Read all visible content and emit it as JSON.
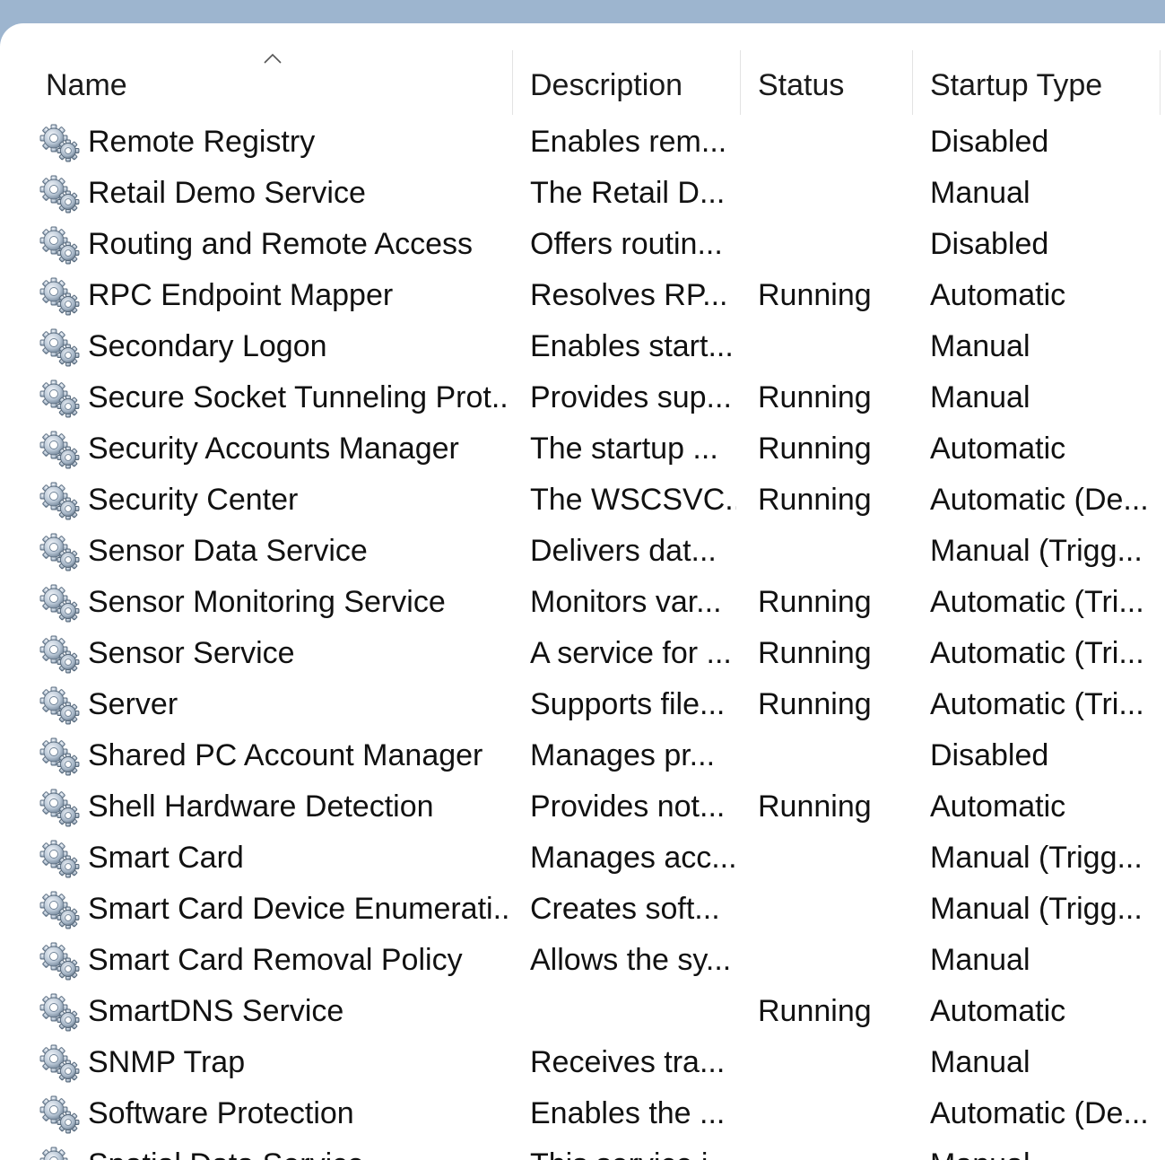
{
  "columns": {
    "name": "Name",
    "description": "Description",
    "status": "Status",
    "startup_type": "Startup Type"
  },
  "sort": {
    "column": "Name",
    "direction": "ascending"
  },
  "colors": {
    "title_bar": "#9db5cf",
    "background": "#ffffff",
    "text": "#111111"
  },
  "rows": [
    {
      "name": "Remote Registry",
      "description": "Enables rem...",
      "status": "",
      "startup": "Disabled"
    },
    {
      "name": "Retail Demo Service",
      "description": "The Retail D...",
      "status": "",
      "startup": "Manual"
    },
    {
      "name": "Routing and Remote Access",
      "description": "Offers routin...",
      "status": "",
      "startup": "Disabled"
    },
    {
      "name": "RPC Endpoint Mapper",
      "description": "Resolves RP...",
      "status": "Running",
      "startup": "Automatic"
    },
    {
      "name": "Secondary Logon",
      "description": "Enables start...",
      "status": "",
      "startup": "Manual"
    },
    {
      "name": "Secure Socket Tunneling Prot...",
      "description": "Provides sup...",
      "status": "Running",
      "startup": "Manual"
    },
    {
      "name": "Security Accounts Manager",
      "description": "The startup ...",
      "status": "Running",
      "startup": "Automatic"
    },
    {
      "name": "Security Center",
      "description": "The WSCSVC...",
      "status": "Running",
      "startup": "Automatic (De..."
    },
    {
      "name": "Sensor Data Service",
      "description": "Delivers dat...",
      "status": "",
      "startup": "Manual (Trigg..."
    },
    {
      "name": "Sensor Monitoring Service",
      "description": "Monitors var...",
      "status": "Running",
      "startup": "Automatic (Tri..."
    },
    {
      "name": "Sensor Service",
      "description": "A service for ...",
      "status": "Running",
      "startup": "Automatic (Tri..."
    },
    {
      "name": "Server",
      "description": "Supports file...",
      "status": "Running",
      "startup": "Automatic (Tri..."
    },
    {
      "name": "Shared PC Account Manager",
      "description": "Manages pr...",
      "status": "",
      "startup": "Disabled"
    },
    {
      "name": "Shell Hardware Detection",
      "description": "Provides not...",
      "status": "Running",
      "startup": "Automatic"
    },
    {
      "name": "Smart Card",
      "description": "Manages acc...",
      "status": "",
      "startup": "Manual (Trigg..."
    },
    {
      "name": "Smart Card Device Enumerati...",
      "description": "Creates soft...",
      "status": "",
      "startup": "Manual (Trigg..."
    },
    {
      "name": "Smart Card Removal Policy",
      "description": "Allows the sy...",
      "status": "",
      "startup": "Manual"
    },
    {
      "name": "SmartDNS Service",
      "description": "",
      "status": "Running",
      "startup": "Automatic"
    },
    {
      "name": "SNMP Trap",
      "description": "Receives tra...",
      "status": "",
      "startup": "Manual"
    },
    {
      "name": "Software Protection",
      "description": "Enables the ...",
      "status": "",
      "startup": "Automatic (De..."
    },
    {
      "name": "Spatial Data Service",
      "description": "This service i...",
      "status": "",
      "startup": "Manual"
    }
  ]
}
